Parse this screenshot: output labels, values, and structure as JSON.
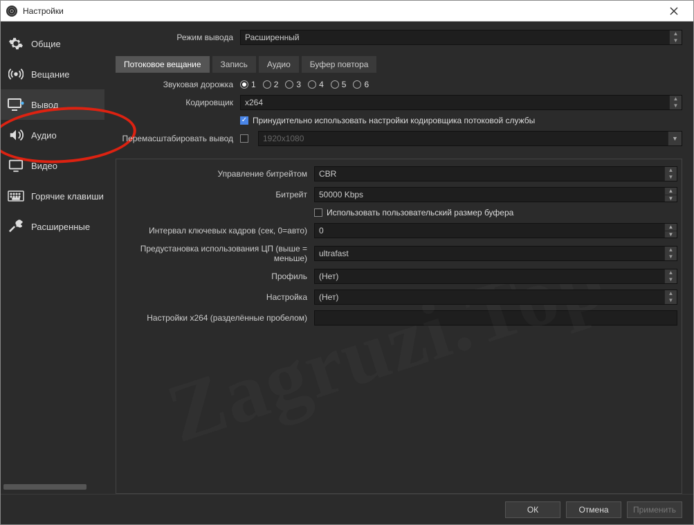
{
  "window": {
    "title": "Настройки"
  },
  "sidebar": {
    "items": [
      {
        "label": "Общие"
      },
      {
        "label": "Вещание"
      },
      {
        "label": "Вывод"
      },
      {
        "label": "Аудио"
      },
      {
        "label": "Видео"
      },
      {
        "label": "Горячие клавиши"
      },
      {
        "label": "Расширенные"
      }
    ]
  },
  "output_mode": {
    "label": "Режим вывода",
    "value": "Расширенный"
  },
  "tabs": {
    "items": [
      {
        "label": "Потоковое вещание"
      },
      {
        "label": "Запись"
      },
      {
        "label": "Аудио"
      },
      {
        "label": "Буфер повтора"
      }
    ]
  },
  "audio_track": {
    "label": "Звуковая дорожка",
    "options": [
      "1",
      "2",
      "3",
      "4",
      "5",
      "6"
    ],
    "selected": "1"
  },
  "encoder": {
    "label": "Кодировщик",
    "value": "x264"
  },
  "enforce": {
    "label": "Принудительно использовать настройки кодировщика потоковой службы",
    "checked": true
  },
  "rescale": {
    "label": "Перемасштабировать вывод",
    "checked": false,
    "placeholder": "1920x1080"
  },
  "rate_control": {
    "label": "Управление битрейтом",
    "value": "CBR"
  },
  "bitrate": {
    "label": "Битрейт",
    "value": "50000 Kbps"
  },
  "custom_buffer": {
    "label": "Использовать пользовательский размер буфера",
    "checked": false
  },
  "keyint": {
    "label": "Интервал ключевых кадров (сек, 0=авто)",
    "value": "0"
  },
  "preset": {
    "label": "Предустановка использования ЦП (выше = меньше)",
    "value": "ultrafast"
  },
  "profile": {
    "label": "Профиль",
    "value": "(Нет)"
  },
  "tune": {
    "label": "Настройка",
    "value": "(Нет)"
  },
  "x264opts": {
    "label": "Настройки x264 (разделённые пробелом)",
    "value": ""
  },
  "footer": {
    "ok": "ОК",
    "cancel": "Отмена",
    "apply": "Применить"
  },
  "watermark": "Zagruzi.Top"
}
